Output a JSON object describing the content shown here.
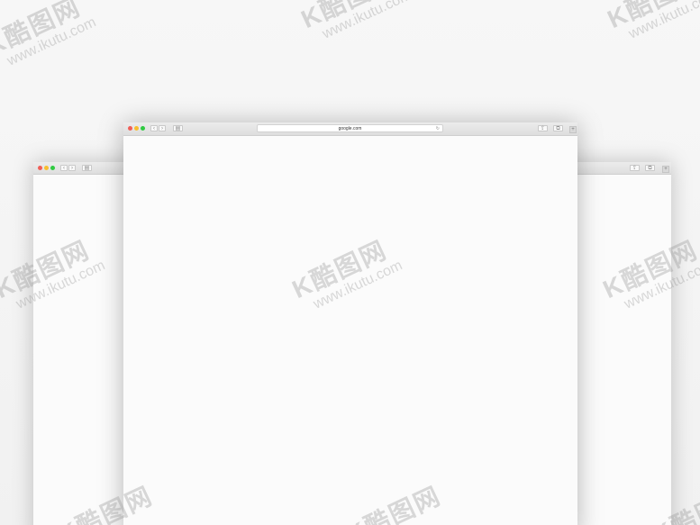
{
  "front_window": {
    "address": "google.com",
    "reload_glyph": "↻",
    "back_glyph": "‹",
    "forward_glyph": "›",
    "sidebar_glyph": "▤",
    "share_glyph": "⇪",
    "tabs_glyph": "⧉",
    "new_tab_glyph": "+"
  },
  "back_left_window": {
    "back_glyph": "‹",
    "forward_glyph": "›",
    "sidebar_glyph": "▤"
  },
  "back_right_window": {
    "share_glyph": "⇪",
    "tabs_glyph": "⧉",
    "new_tab_glyph": "+"
  },
  "watermark": {
    "logo": "K酷图网",
    "url": "www.ikutu.com"
  },
  "colors": {
    "close": "#f05e57",
    "minimize": "#f8be2e",
    "maximize": "#2fca41"
  }
}
